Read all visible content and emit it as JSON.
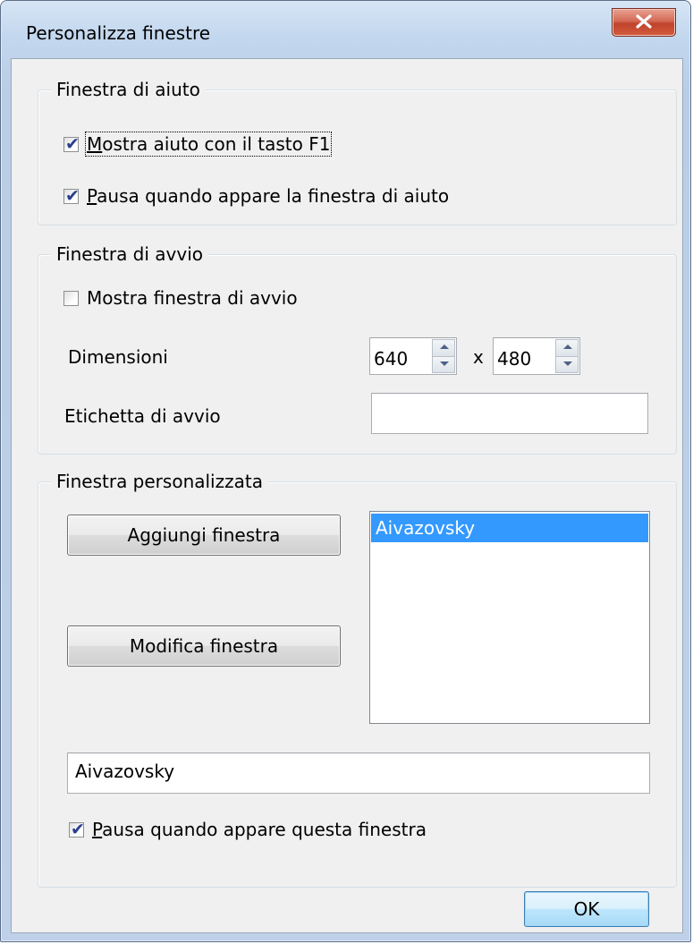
{
  "window": {
    "title": "Personalizza finestre"
  },
  "help_group": {
    "legend": "Finestra di aiuto",
    "show_help_f1": {
      "accel": "M",
      "rest": "ostra aiuto con il tasto F1",
      "checked": true
    },
    "pause_on_help": {
      "accel": "P",
      "rest": "ausa quando appare la finestra di aiuto",
      "checked": true
    }
  },
  "startup_group": {
    "legend": "Finestra di avvio",
    "show_startup": {
      "label": "Mostra finestra di avvio",
      "checked": false
    },
    "dimensions_label": "Dimensioni",
    "width_value": "640",
    "separator": "x",
    "height_value": "480",
    "startup_label_label": "Etichetta di avvio",
    "startup_label_value": ""
  },
  "custom_group": {
    "legend": "Finestra personalizzata",
    "add_button": "Aggiungi finestra",
    "edit_button": "Modifica finestra",
    "list_items": [
      "Aivazovsky"
    ],
    "selected_item": "Aivazovsky",
    "name_value": "Aivazovsky",
    "pause_on_window": {
      "accel": "P",
      "rest": "ausa quando appare questa finestra",
      "checked": true
    }
  },
  "footer": {
    "ok_button": "OK"
  },
  "colors": {
    "selection": "#3399ff",
    "close_button": "#c0432c",
    "dialog_background": "#f0f0f0"
  }
}
